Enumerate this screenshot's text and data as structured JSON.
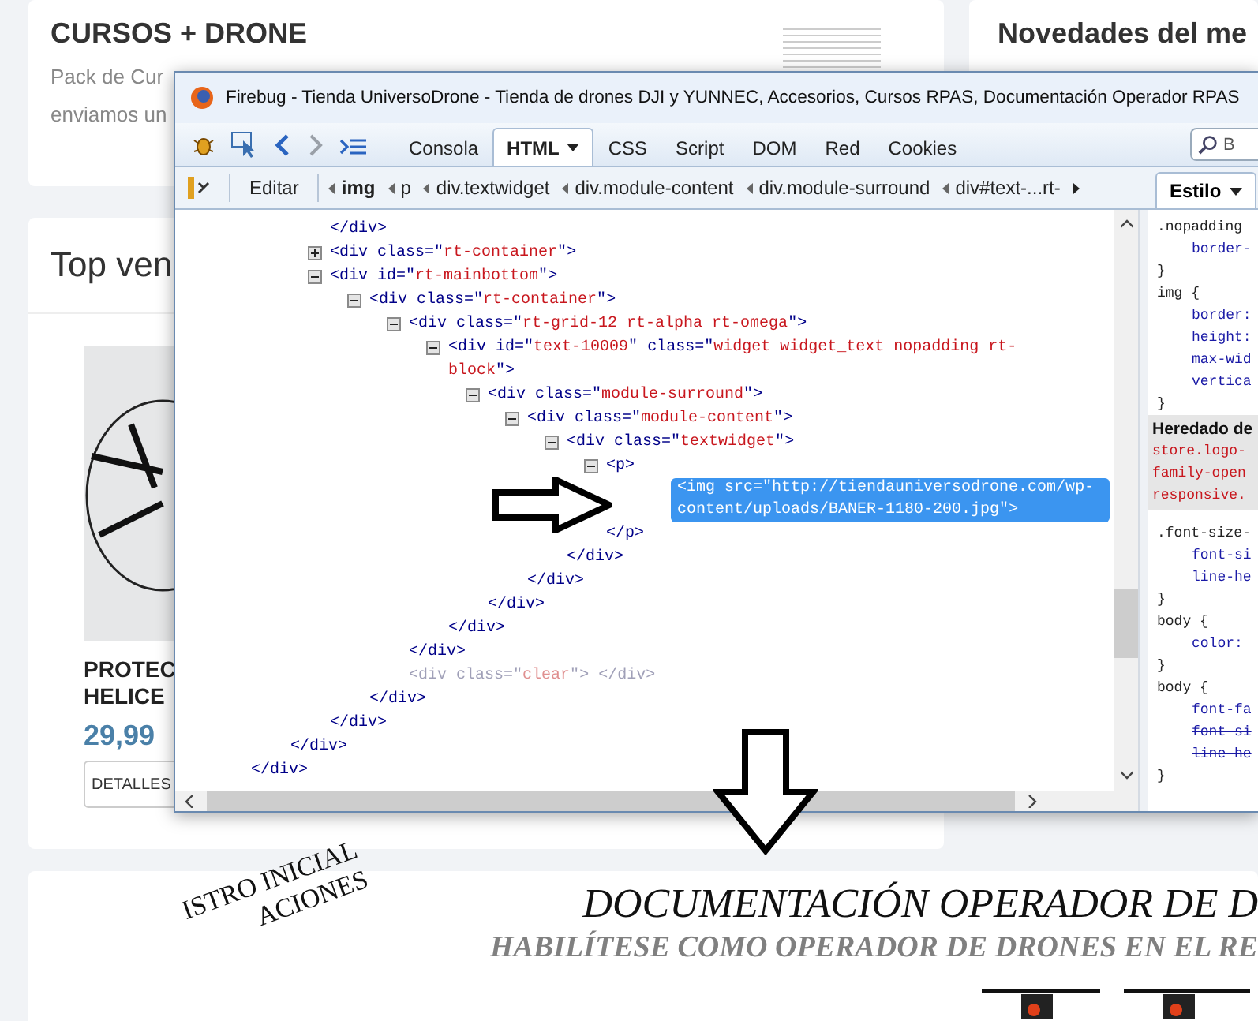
{
  "page": {
    "course_card": {
      "title": "CURSOS + DRONE",
      "text_lines": [
        "Pack de Cur",
        "enviamos un"
      ]
    },
    "news_card": {
      "title": "Novedades del me"
    },
    "top_sellers": {
      "title": "Top ven",
      "product": {
        "name_lines": [
          "PROTEC",
          "HELICE"
        ],
        "price": "29,99",
        "button": "DETALLES"
      }
    },
    "banner": {
      "title": "DOCUMENTACIÓN OPERADOR DE D",
      "subtitle": "HABILÍTESE COMO OPERADOR DE DRONES EN EL RE",
      "stamp_lines": [
        "ISTRO INICIAL",
        "ACIONES"
      ]
    }
  },
  "firebug": {
    "title": "Firebug - Tienda UniversoDrone - Tienda de drones DJI y YUNNEC, Accesorios, Cursos RPAS, Documentación Operador RPAS",
    "tabs": [
      {
        "label": "Consola",
        "selected": false,
        "menu": false
      },
      {
        "label": "HTML",
        "selected": true,
        "menu": true
      },
      {
        "label": "CSS",
        "selected": false,
        "menu": false
      },
      {
        "label": "Script",
        "selected": false,
        "menu": false
      },
      {
        "label": "DOM",
        "selected": false,
        "menu": false
      },
      {
        "label": "Red",
        "selected": false,
        "menu": false
      },
      {
        "label": "Cookies",
        "selected": false,
        "menu": false
      }
    ],
    "search": {
      "placeholder": "B"
    },
    "edit_button": "Editar",
    "breadcrumb": [
      {
        "label": "img",
        "selected": true
      },
      {
        "label": "p",
        "selected": false
      },
      {
        "label": "div.textwidget",
        "selected": false
      },
      {
        "label": "div.module-content",
        "selected": false
      },
      {
        "label": "div.module-surround",
        "selected": false
      },
      {
        "label": "div#text-...rt-",
        "selected": false
      }
    ],
    "side_tab": {
      "label": "Estilo"
    },
    "html_tree": [
      {
        "close": "</div>",
        "children": [
          {
            "close": "</div>",
            "children": [
              {
                "close": "</div>"
              },
              {
                "open": "<div class=\"rt-container\">",
                "expanded": false,
                "selected": false,
                "dimmed": false
              },
              {
                "open": "<div id=\"rt-mainbottom\">",
                "expanded": true,
                "selected": false,
                "dimmed": false,
                "close": "</div>",
                "children": [
                  {
                    "open": "<div class=\"rt-container\">",
                    "expanded": true,
                    "selected": false,
                    "dimmed": false,
                    "close": "</div>",
                    "children": [
                      {
                        "open": "<div class=\"rt-grid-12 rt-alpha rt-omega\">",
                        "expanded": true,
                        "selected": false,
                        "dimmed": false,
                        "close": "</div>",
                        "children": [
                          {
                            "open": "<div id=\"text-10009\" class=\"widget widget_text nopadding rt-block\">",
                            "expanded": true,
                            "selected": false,
                            "dimmed": false,
                            "close": "</div>",
                            "children": [
                              {
                                "open": "<div class=\"module-surround\">",
                                "expanded": true,
                                "selected": false,
                                "dimmed": false,
                                "close": "</div>",
                                "children": [
                                  {
                                    "open": "<div class=\"module-content\">",
                                    "expanded": true,
                                    "selected": false,
                                    "dimmed": false,
                                    "close": "</div>",
                                    "children": [
                                      {
                                        "open": "<div class=\"textwidget\">",
                                        "expanded": true,
                                        "selected": false,
                                        "dimmed": false,
                                        "close": "</div>",
                                        "children": [
                                          {
                                            "open": "<p>",
                                            "expanded": true,
                                            "selected": false,
                                            "dimmed": false,
                                            "close": "</p>",
                                            "children": [
                                              {
                                                "open": "<img src=\"http://tiendauniversodrone.com/wp-content/uploads/BANER-1180-200.jpg\">",
                                                "selected": true,
                                                "dimmed": false
                                              }
                                            ]
                                          }
                                        ]
                                      }
                                    ]
                                  }
                                ]
                              }
                            ]
                          }
                        ]
                      },
                      {
                        "open": "<div class=\"clear\"> </div>",
                        "selected": false,
                        "dimmed": true
                      }
                    ]
                  }
                ]
              }
            ]
          }
        ]
      }
    ],
    "css_rules": [
      {
        "selector": ".nopadding",
        "properties": [
          {
            "text": "border-",
            "overridden": false
          }
        ],
        "close": "}"
      },
      {
        "selector": "img {",
        "properties": [
          {
            "text": "border:",
            "overridden": false
          },
          {
            "text": "height:",
            "overridden": false
          },
          {
            "text": "max-wid",
            "overridden": false
          },
          {
            "text": "vertica",
            "overridden": false
          }
        ],
        "close": "}"
      }
    ],
    "inherited": {
      "header": "Heredado de",
      "source_lines": [
        "store.logo-",
        "family-open",
        "responsive."
      ]
    },
    "inherited_rules": [
      {
        "selector": ".font-size-",
        "properties": [
          {
            "text": "font-si",
            "overridden": false
          },
          {
            "text": "line-he",
            "overridden": false
          }
        ],
        "close": "}"
      },
      {
        "selector": "body {",
        "properties": [
          {
            "text": "color:",
            "overridden": false
          }
        ],
        "close": "}"
      },
      {
        "selector": "body {",
        "properties": [
          {
            "text": "font-fa",
            "overridden": false
          },
          {
            "text": "font-si",
            "overridden": true
          },
          {
            "text": "line-he",
            "overridden": true
          }
        ],
        "close": "}"
      }
    ]
  }
}
